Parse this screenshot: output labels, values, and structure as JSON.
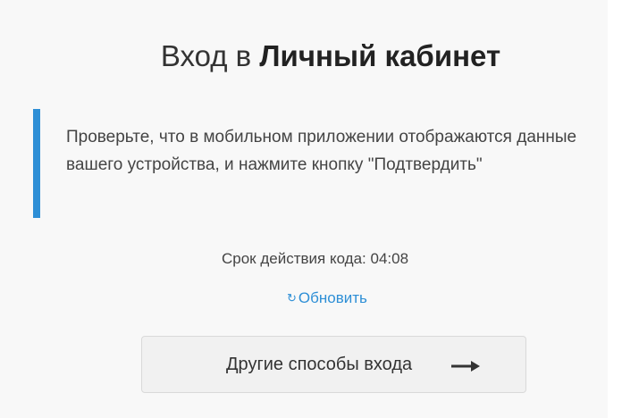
{
  "header": {
    "title_prefix": "Вход в",
    "title_strong": "Личный кабинет"
  },
  "notice": {
    "text": "Проверьте, что в мобильном приложении отображаются данные вашего устройства, и нажмите кнопку \"Подтвердить\"",
    "accent_color": "#2e8fd6"
  },
  "timer": {
    "text": "Срок действия кода: 04:08"
  },
  "refresh": {
    "icon": "refresh-icon",
    "label": "Обновить"
  },
  "other_methods": {
    "label": "Другие способы входа",
    "icon": "arrow-right-icon"
  }
}
